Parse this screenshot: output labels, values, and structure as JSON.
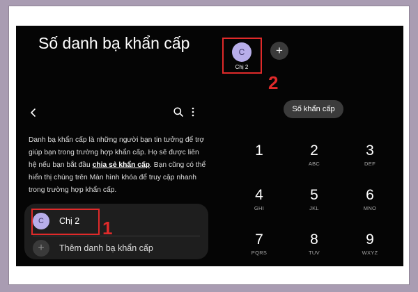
{
  "left_screen": {
    "title": "Số danh bạ khẩn cấp",
    "description_before_link": "Danh bạ khẩn cấp là những người bạn tin tưởng để trợ giúp bạn trong trường hợp khẩn cấp. Họ sẽ được liên hệ nếu bạn bắt đầu ",
    "description_link": "chia sẻ khẩn cấp",
    "description_after_link": ". Bạn cũng có thể hiển thị chúng trên Màn hình khóa để truy cập nhanh trong trường hợp khẩn cấp.",
    "contact": {
      "initial": "C",
      "name": "Chị 2"
    },
    "add_contact_label": "Thêm danh bạ khẩn cấp",
    "add_symbol": "+",
    "annotation_number": "1"
  },
  "right_screen": {
    "favorite": {
      "initial": "C",
      "name": "Chị 2"
    },
    "plus_symbol": "+",
    "annotation_number": "2",
    "emergency_chip_label": "Số khẩn cấp",
    "keypad": [
      {
        "digit": "1",
        "letters": ""
      },
      {
        "digit": "2",
        "letters": "ABC"
      },
      {
        "digit": "3",
        "letters": "DEF"
      },
      {
        "digit": "4",
        "letters": "GHI"
      },
      {
        "digit": "5",
        "letters": "JKL"
      },
      {
        "digit": "6",
        "letters": "MNO"
      },
      {
        "digit": "7",
        "letters": "PQRS"
      },
      {
        "digit": "8",
        "letters": "TUV"
      },
      {
        "digit": "9",
        "letters": "WXYZ"
      }
    ]
  },
  "colors": {
    "annotation_red": "#e02a2a",
    "avatar_lavender": "#b8aeea",
    "screen_background": "#050505",
    "page_background": "#a99cb2"
  },
  "icons": [
    "chevron-left-icon",
    "search-icon",
    "more-vertical-icon",
    "plus-icon"
  ]
}
